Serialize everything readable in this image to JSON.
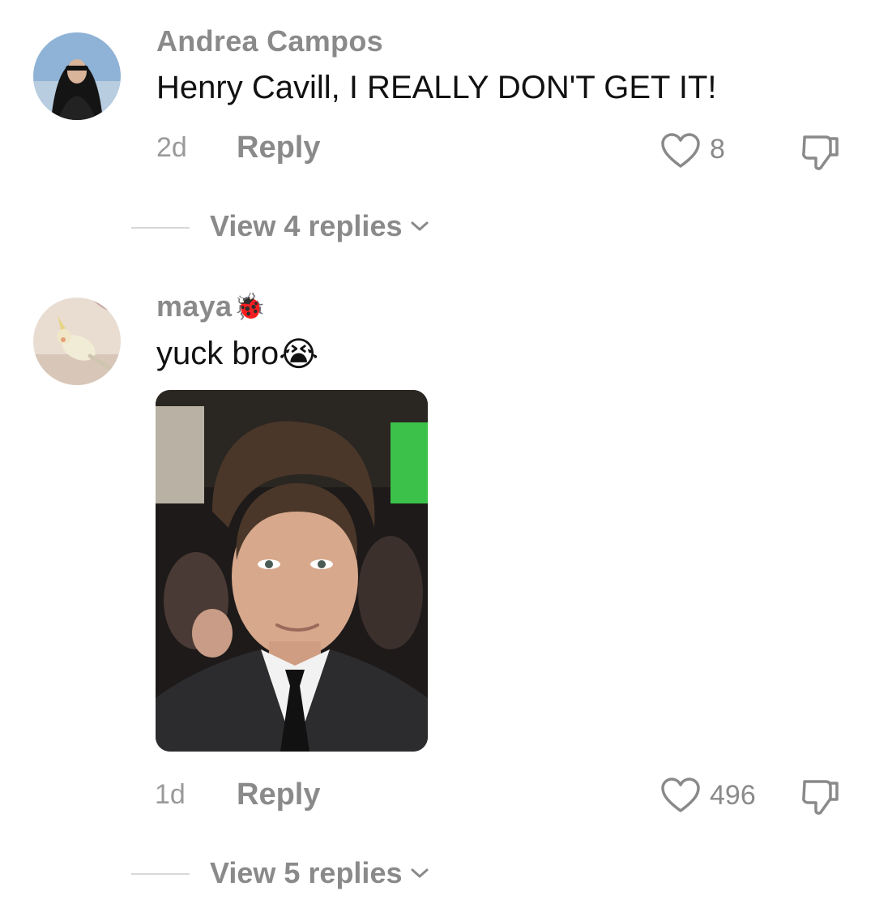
{
  "comments": [
    {
      "username": "Andrea Campos",
      "text": "Henry Cavill, I REALLY DON'T GET IT!",
      "time": "2d",
      "reply_label": "Reply",
      "likes": "8",
      "view_replies": "View 4 replies"
    },
    {
      "username": "maya",
      "username_emoji": "🐞",
      "text": "yuck bro",
      "text_emoji": "😭",
      "time": "1d",
      "reply_label": "Reply",
      "likes": "496",
      "view_replies": "View 5 replies"
    }
  ],
  "icons": {
    "like": "heart-outline-icon",
    "dislike": "thumbs-down-icon",
    "chevron": "chevron-down-icon"
  },
  "colors": {
    "secondary_text": "#8a8a8a",
    "primary_text": "#111111"
  }
}
